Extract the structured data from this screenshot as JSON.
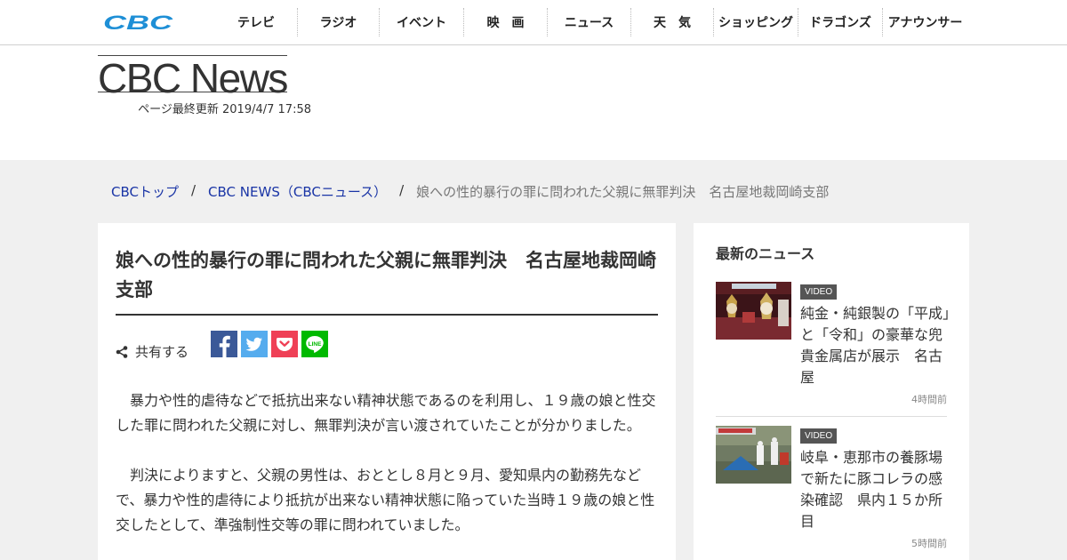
{
  "nav": {
    "logo": "CBC",
    "items": [
      {
        "label": "テレビ"
      },
      {
        "label": "ラジオ"
      },
      {
        "label": "イベント"
      },
      {
        "label": "映　画"
      },
      {
        "label": "ニュース"
      },
      {
        "label": "天　気"
      },
      {
        "label": "ショッピング"
      },
      {
        "label": "ドラゴンズ"
      },
      {
        "label": "アナウンサー"
      }
    ]
  },
  "header": {
    "title": "CBC News",
    "updated": "ページ最終更新  2019/4/7 17:58"
  },
  "breadcrumb": {
    "items": [
      "CBCトップ",
      "CBC NEWS（CBCニュース）"
    ],
    "separator": "/",
    "current": "娘への性的暴行の罪に問われた父親に無罪判決　名古屋地裁岡崎支部"
  },
  "article": {
    "title": "娘への性的暴行の罪に問われた父親に無罪判決　名古屋地裁岡崎支部",
    "share_label": "共有する",
    "sns": [
      {
        "name": "facebook",
        "color": "#3b5998"
      },
      {
        "name": "twitter",
        "color": "#55acee"
      },
      {
        "name": "pocket",
        "color": "#ef4056"
      },
      {
        "name": "line",
        "color": "#00b900"
      }
    ],
    "paragraphs": [
      "　暴力や性的虐待などで抵抗出来ない精神状態であるのを利用し、１９歳の娘と性交した罪に問われた父親に対し、無罪判決が言い渡されていたことが分かりました。",
      "　判決によりますと、父親の男性は、おととし８月と９月、愛知県内の勤務先などで、暴力や性的虐待により抵抗が出来ない精神状態に陥っていた当時１９歳の娘と性交したとして、準強制性交等の罪に問われていました。"
    ]
  },
  "sidebar": {
    "heading": "最新のニュース",
    "items": [
      {
        "badge": "VIDEO",
        "title": "純金・純銀製の「平成」と「令和」の豪華な兜　貴金属店が展示　名古屋",
        "time": "4時間前"
      },
      {
        "badge": "VIDEO",
        "title": "岐阜・恵那市の養豚場で新たに豚コレラの感染確認　県内１５か所目",
        "time": "5時間前"
      }
    ]
  },
  "colors": {
    "link": "#1a35a6",
    "logo": "#1e8fd6",
    "band": "#f0f0f0"
  }
}
